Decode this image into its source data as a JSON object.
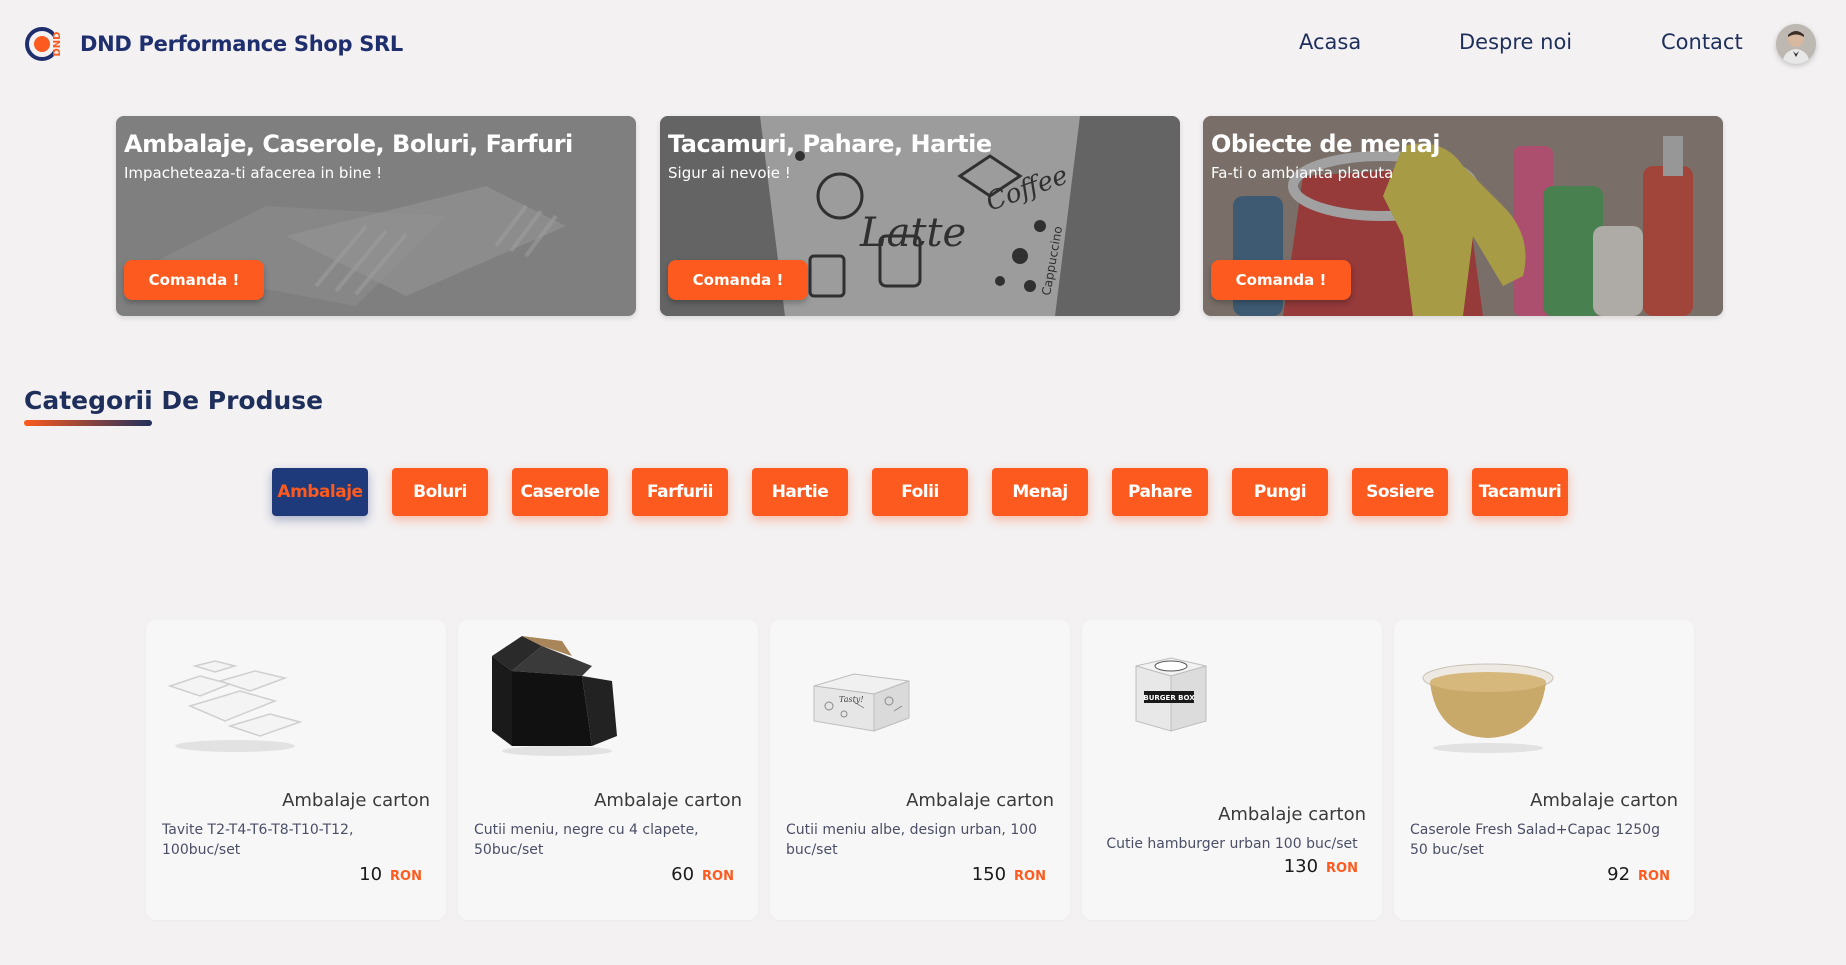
{
  "header": {
    "logo_text": "DND",
    "brand": "DND Performance Shop SRL",
    "nav": [
      "Acasa",
      "Despre noi",
      "Contact"
    ]
  },
  "banners": [
    {
      "title": "Ambalaje, Caserole, Boluri, Farfuri",
      "subtitle": "Impacheteaza-ti afacerea in bine !",
      "button": "Comanda !"
    },
    {
      "title": "Tacamuri, Pahare, Hartie",
      "subtitle": "Sigur ai nevoie !",
      "button": "Comanda !",
      "image_text": [
        "Coffee",
        "Latte",
        "Cappuccino"
      ]
    },
    {
      "title": "Obiecte de menaj",
      "subtitle": "Fa-ti o ambianta placuta",
      "button": "Comanda !"
    }
  ],
  "section": {
    "title": "Categorii De Produse"
  },
  "categories": [
    "Ambalaje",
    "Boluri",
    "Caserole",
    "Farfurii",
    "Hartie",
    "Folii",
    "Menaj",
    "Pahare",
    "Pungi",
    "Sosiere",
    "Tacamuri"
  ],
  "active_category": "Ambalaje",
  "products": [
    {
      "category": "Ambalaje carton",
      "description": "Tavite T2-T4-T6-T8-T10-T12, 100buc/set",
      "price": "10",
      "currency": "RON"
    },
    {
      "category": "Ambalaje carton",
      "description": "Cutii meniu, negre cu 4 clapete, 50buc/set",
      "price": "60",
      "currency": "RON"
    },
    {
      "category": "Ambalaje carton",
      "description": "Cutii meniu albe, design urban, 100 buc/set",
      "price": "150",
      "currency": "RON",
      "image_text": "Tasty!"
    },
    {
      "category": "Ambalaje carton",
      "description": "Cutie hamburger urban 100 buc/set",
      "price": "130",
      "currency": "RON",
      "image_text": "BURGER BOX"
    },
    {
      "category": "Ambalaje carton",
      "description": "Caserole Fresh Salad+Capac 1250g 50 buc/set",
      "price": "92",
      "currency": "RON"
    }
  ],
  "colors": {
    "accent": "#fc5a1e",
    "brand": "#1f2f6e",
    "background": "#f3f1f2"
  }
}
